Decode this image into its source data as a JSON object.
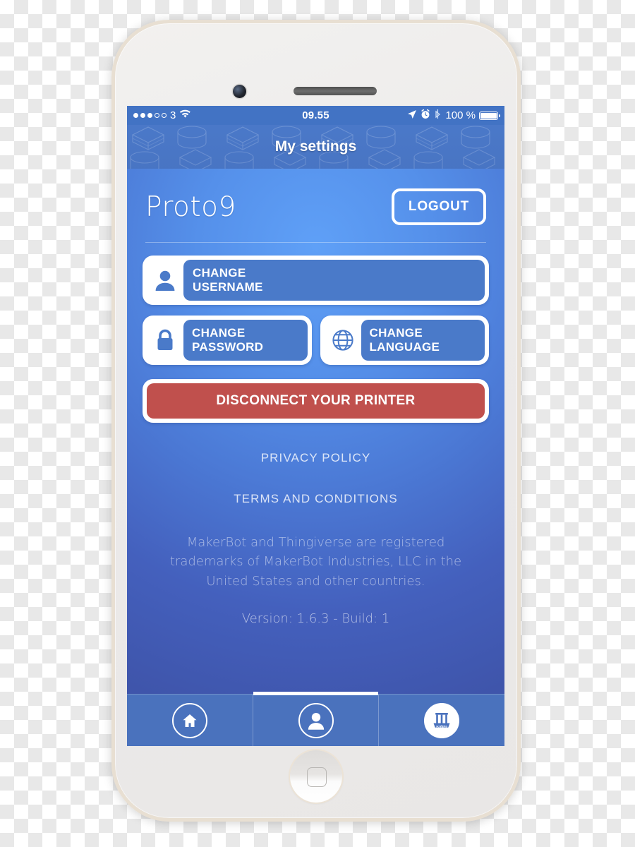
{
  "status_bar": {
    "signal_dots_filled": 3,
    "signal_dots_total": 5,
    "carrier": "3",
    "wifi_icon": "wifi-icon",
    "time": "09.55",
    "location_icon": "location-arrow-icon",
    "alarm_icon": "alarm-clock-icon",
    "bluetooth_icon": "bluetooth-icon",
    "battery_percent": "100 %",
    "battery_level": 100
  },
  "nav_bar": {
    "title": "My settings",
    "pattern": "isometric-3d-shapes"
  },
  "account": {
    "username": "Proto9",
    "logout_label": "LOGOUT"
  },
  "options": [
    {
      "id": "change-username",
      "icon": "person-icon",
      "line1": "CHANGE",
      "line2": "USERNAME"
    },
    {
      "id": "change-password",
      "icon": "lock-icon",
      "line1": "CHANGE",
      "line2": "PASSWORD"
    },
    {
      "id": "change-language",
      "icon": "globe-icon",
      "line1": "CHANGE",
      "line2": "LANGUAGE"
    }
  ],
  "disconnect": {
    "label": "DISCONNECT YOUR PRINTER",
    "color": "#c0504d"
  },
  "legal": {
    "privacy_policy": "PRIVACY POLICY",
    "terms": "TERMS AND CONDITIONS",
    "trademark": "MakerBot and Thingiverse are registered trademarks of MakerBot Industries, LLC in the United States and other countries.",
    "version": "Version: 1.6.3 - Build: 1"
  },
  "tab_bar": {
    "tabs": [
      {
        "id": "home",
        "icon": "home-icon",
        "active": false
      },
      {
        "id": "profile",
        "icon": "person-icon",
        "active": true
      },
      {
        "id": "printer",
        "icon": "sculpto-printer-icon",
        "brand": "sculpto",
        "active": false
      }
    ]
  },
  "colors": {
    "accent_blue": "#4a7ac9",
    "nav_blue": "#4c7ccd",
    "status_blue": "#4273c4",
    "screen_light": "#5fa0f7",
    "screen_dark": "#3f55ab",
    "tabbar_blue": "#4a72bd",
    "danger_red": "#c0504d",
    "white": "#ffffff"
  }
}
